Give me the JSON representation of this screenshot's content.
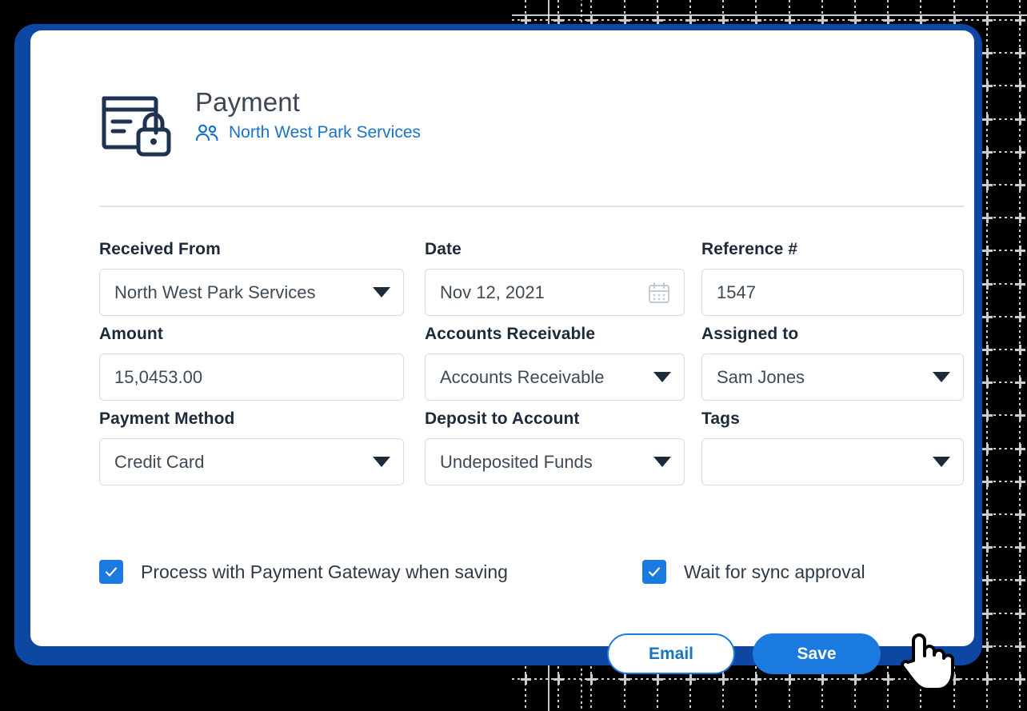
{
  "header": {
    "icon": "credit-card-lock-icon",
    "title": "Payment",
    "subtitle_icon": "people-icon",
    "subtitle": "North West Park Services"
  },
  "form": {
    "rows": [
      [
        {
          "label": "Received From",
          "type": "select",
          "value": "North West Park Services",
          "icon": "chevron-down-icon"
        },
        {
          "label": "Date",
          "type": "date",
          "value": "Nov 12, 2021",
          "icon": "calendar-icon"
        },
        {
          "label": "Reference #",
          "type": "text",
          "value": "1547",
          "icon": ""
        }
      ],
      [
        {
          "label": "Amount",
          "type": "text",
          "value": "15,0453.00",
          "icon": ""
        },
        {
          "label": "Accounts Receivable",
          "type": "select",
          "value": "Accounts Receivable",
          "icon": "chevron-down-icon"
        },
        {
          "label": "Assigned to",
          "type": "select",
          "value": "Sam Jones",
          "icon": "chevron-down-icon"
        }
      ],
      [
        {
          "label": "Payment Method",
          "type": "select",
          "value": "Credit Card",
          "icon": "chevron-down-icon"
        },
        {
          "label": "Deposit to Account",
          "type": "select",
          "value": "Undeposited Funds",
          "icon": "chevron-down-icon"
        },
        {
          "label": "Tags",
          "type": "select",
          "value": "",
          "icon": "chevron-down-icon"
        }
      ]
    ]
  },
  "checkboxes": [
    {
      "label": "Process with Payment Gateway when saving",
      "checked": true
    },
    {
      "label": "Wait for sync approval",
      "checked": true
    }
  ],
  "actions": {
    "email_label": "Email",
    "save_label": "Save"
  },
  "colors": {
    "frame_blue": "#0d47a1",
    "accent_blue": "#1a7ae0",
    "link_blue": "#1a73c7",
    "label_dark": "#1c2a3a",
    "value_gray": "#3f4a57",
    "border_gray": "#d5dde5",
    "backdrop": "#000000"
  }
}
